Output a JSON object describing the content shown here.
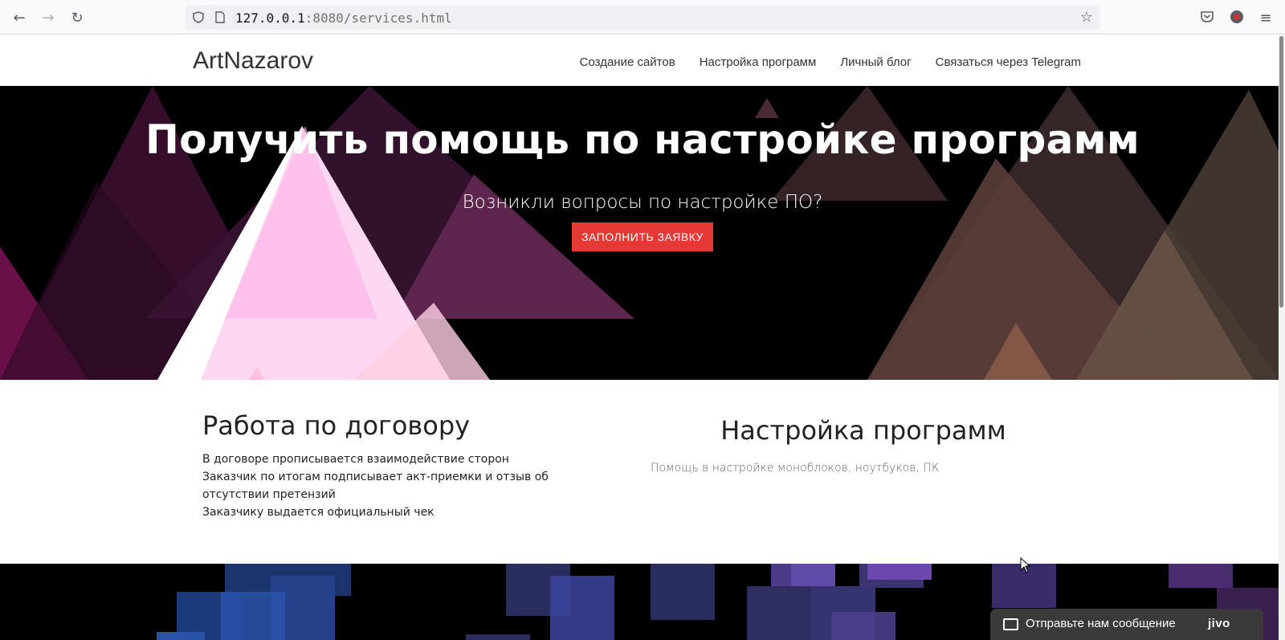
{
  "browser": {
    "url_host": "127.0.0.1",
    "url_rest": ":8080/services.html"
  },
  "site": {
    "brand": "ArtNazarov",
    "menu": [
      {
        "label": "Создание сайтов"
      },
      {
        "label": "Настройка программ"
      },
      {
        "label": "Личный блог"
      },
      {
        "label": "Связаться через Telegram"
      }
    ]
  },
  "hero": {
    "title": "Получить помощь по настройке программ",
    "subtitle": "Возникли вопросы по настройке ПО?",
    "cta_label": "ЗАПОЛНИТЬ ЗАЯВКУ"
  },
  "contract": {
    "heading": "Работа по договору",
    "items": [
      "В договоре прописывается взаимодействие сторон",
      "Заказчик по итогам подписывает акт-приемки и отзыв об отсутствии претензий",
      "Заказчику выдается официальный чек"
    ]
  },
  "services": {
    "heading": "Настройка программ",
    "description": "Помощь в настройке моноблоков, ноутбуков, ПК"
  },
  "chat": {
    "message": "Отправьте нам сообщение",
    "logo": "jivo"
  },
  "colors": {
    "cta": "#e53935",
    "hero_bg": "#000000",
    "chat_bg": "#3a3a3a"
  }
}
